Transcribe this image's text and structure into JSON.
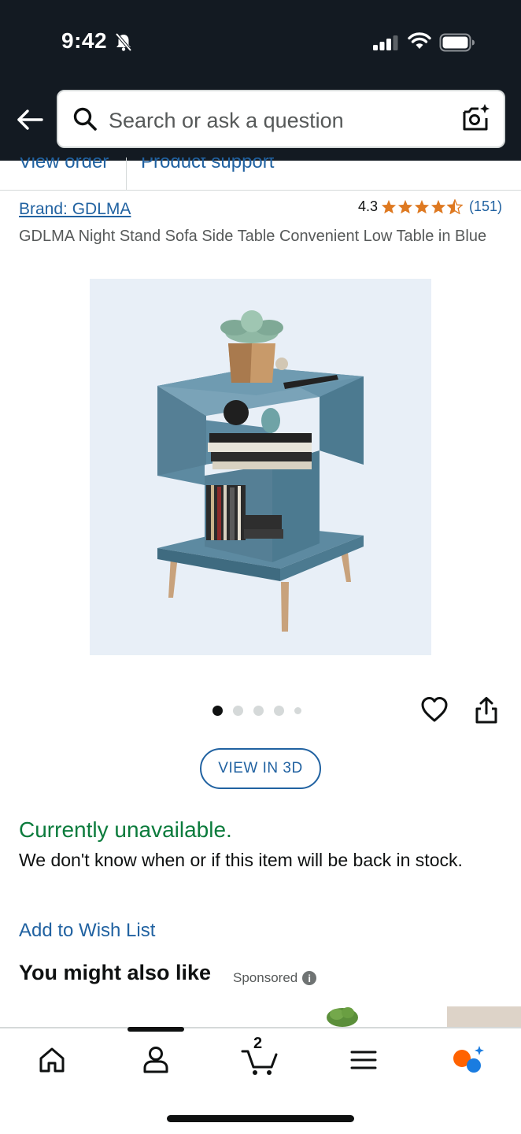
{
  "status_bar": {
    "time": "9:42"
  },
  "search": {
    "placeholder": "Search or ask a question"
  },
  "order_links": {
    "view_order": "View order",
    "product_support": "Product support"
  },
  "product": {
    "brand": "Brand: GDLMA",
    "rating": "4.3",
    "stars": 4.3,
    "review_count": "(151)",
    "title": "GDLMA Night Stand Sofa Side Table Convenient Low Table in Blue",
    "image_count": 5,
    "active_image_index": 0,
    "view_3d_label": "VIEW IN 3D"
  },
  "availability": {
    "status": "Currently unavailable.",
    "message": "We don't know when or if this item will be back in stock."
  },
  "wishlist": {
    "label": "Add to Wish List"
  },
  "recommendations": {
    "heading": "You might also like",
    "sponsored": "Sponsored",
    "info_icon": "i"
  },
  "bottom_nav": {
    "items": [
      {
        "name": "home",
        "icon": "home-icon"
      },
      {
        "name": "account",
        "icon": "person-icon"
      },
      {
        "name": "cart",
        "icon": "cart-icon",
        "count": "2"
      },
      {
        "name": "menu",
        "icon": "menu-icon"
      },
      {
        "name": "rufus",
        "icon": "rufus-icon"
      }
    ]
  },
  "colors": {
    "header_bg": "#131a22",
    "link": "#2162a1",
    "available_green": "#0b7b3c",
    "star": "#de7921",
    "rufus_orange": "#ff6200",
    "rufus_blue": "#1a7ce0"
  }
}
